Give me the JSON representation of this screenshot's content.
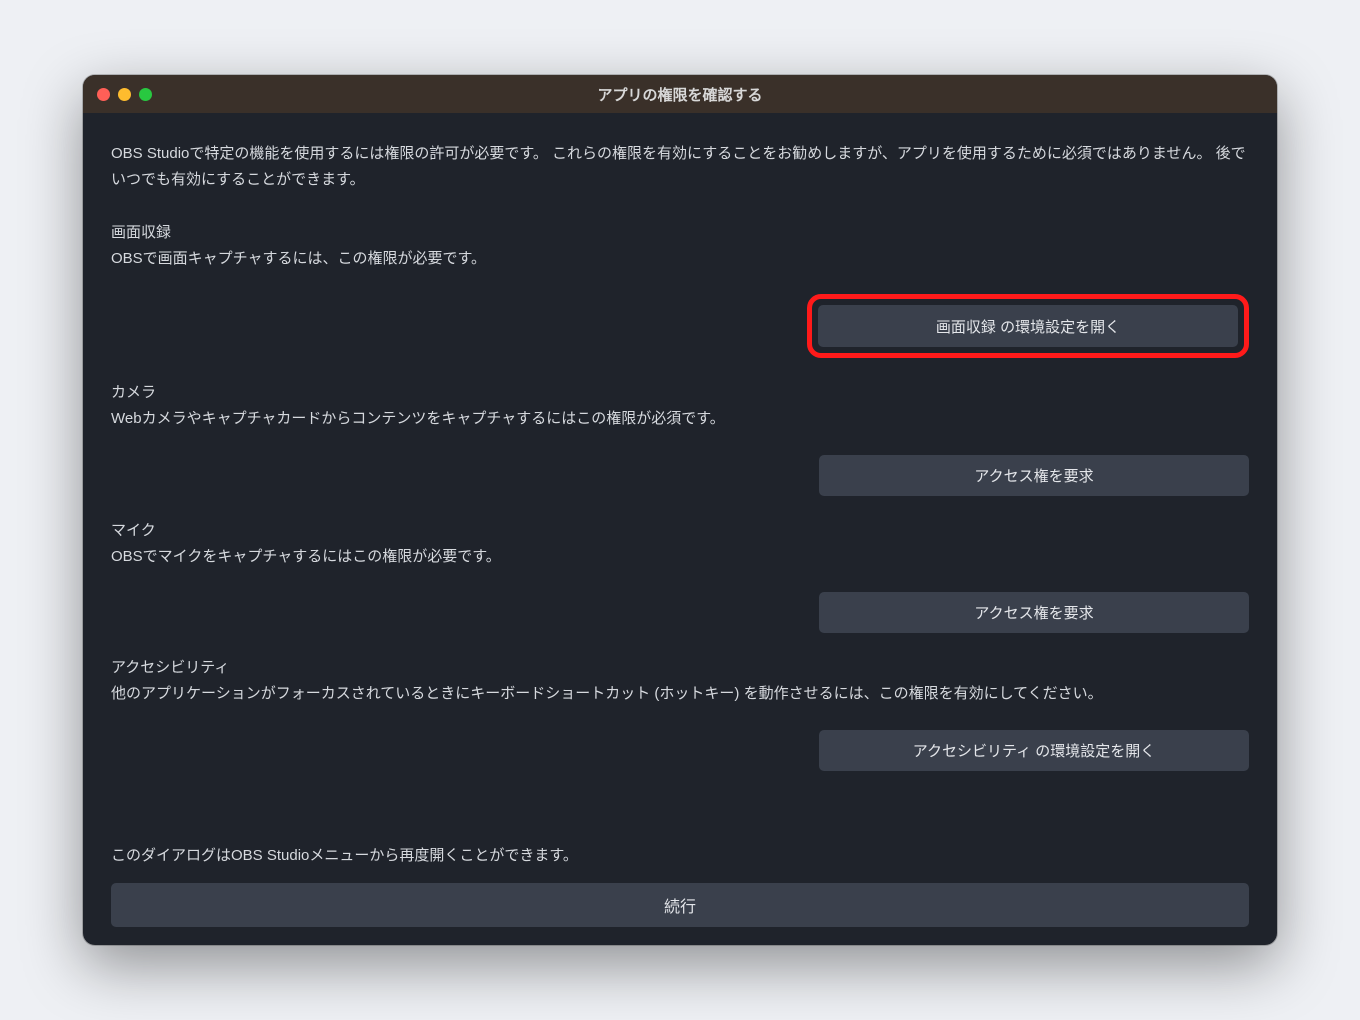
{
  "window": {
    "title": "アプリの権限を確認する"
  },
  "intro": "OBS Studioで特定の機能を使用するには権限の許可が必要です。 これらの権限を有効にすることをお勧めしますが、アプリを使用するために必須ではありません。 後でいつでも有効にすることができます。",
  "sections": {
    "screen_recording": {
      "title": "画面収録",
      "desc": "OBSで画面キャプチャするには、この権限が必要です。",
      "button": "画面収録 の環境設定を開く"
    },
    "camera": {
      "title": "カメラ",
      "desc": "Webカメラやキャプチャカードからコンテンツをキャプチャするにはこの権限が必須です。",
      "button": "アクセス権を要求"
    },
    "microphone": {
      "title": "マイク",
      "desc": "OBSでマイクをキャプチャするにはこの権限が必要です。",
      "button": "アクセス権を要求"
    },
    "accessibility": {
      "title": "アクセシビリティ",
      "desc": "他のアプリケーションがフォーカスされているときにキーボードショートカット (ホットキー) を動作させるには、この権限を有効にしてください。",
      "button": "アクセシビリティ の環境設定を開く"
    }
  },
  "footer_note": "このダイアログはOBS Studioメニューから再度開くことができます。",
  "continue_button": "続行"
}
